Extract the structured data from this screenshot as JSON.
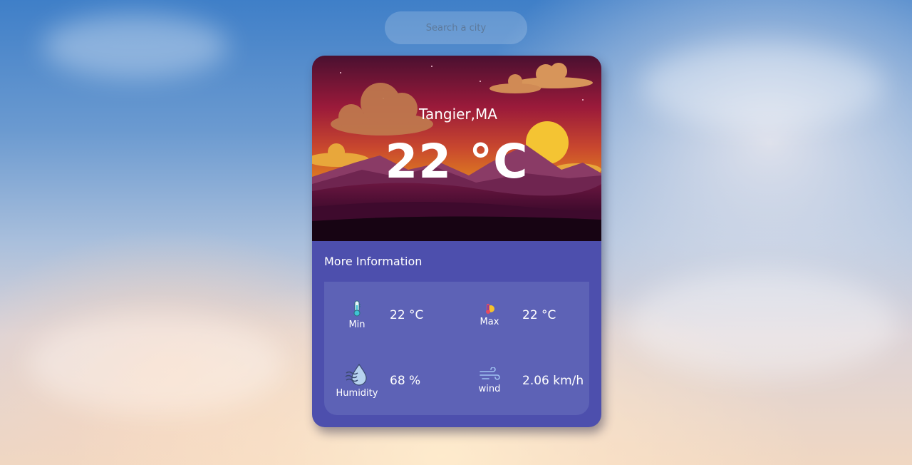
{
  "search": {
    "placeholder": "Search a city"
  },
  "weather": {
    "city": "Tangier,MA",
    "temperature": "22 °C"
  },
  "more_info": {
    "title": "More Information",
    "min": {
      "label": "Min",
      "value": "22 °C",
      "icon": "thermometer-icon"
    },
    "max": {
      "label": "Max",
      "value": "22 °C",
      "icon": "hot-thermometer-icon"
    },
    "humidity": {
      "label": "Humidity",
      "value": "68 %",
      "icon": "humidity-drop-icon"
    },
    "wind": {
      "label": "wind",
      "value": "2.06 km/h",
      "icon": "wind-icon"
    }
  },
  "colors": {
    "card": "#4d4fad",
    "panel": "#5d62b6",
    "text": "#ffffff"
  }
}
